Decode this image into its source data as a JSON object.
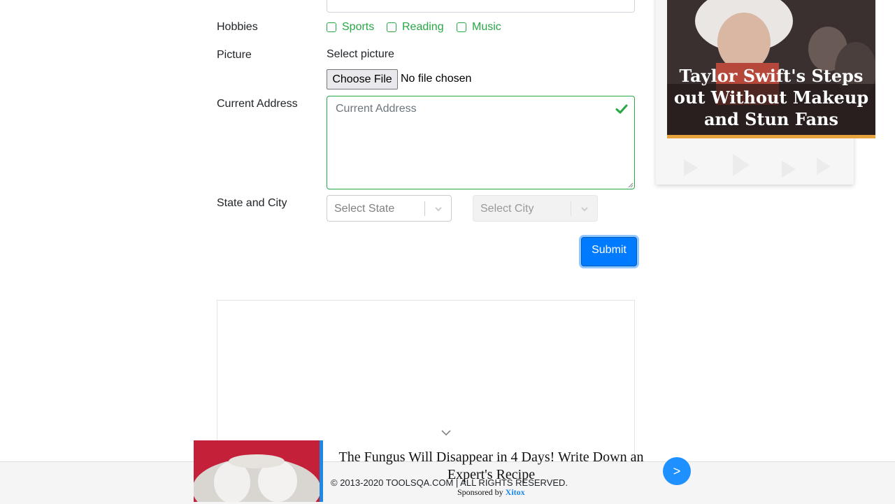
{
  "form": {
    "hobbies_label": "Hobbies",
    "hobbies": [
      "Sports",
      "Reading",
      "Music"
    ],
    "picture_label": "Picture",
    "select_picture": "Select picture",
    "choose_file": "Choose File",
    "file_status": "No file chosen",
    "address_label": "Current Address",
    "address_placeholder": "Current Address",
    "state_city_label": "State and City",
    "state_placeholder": "Select State",
    "city_placeholder": "Select City",
    "submit": "Submit"
  },
  "side_ad": {
    "caption": "Taylor Swift's Steps out Without Makeup and Stun Fans"
  },
  "footer": {
    "copyright": "© 2013-2020 TOOLSQA.COM | ALL RIGHTS RESERVED."
  },
  "bottom_ad": {
    "title": "The Fungus Will Disappear in 4 Days! Write Down an Expert's Recipe",
    "sponsored_prefix": "Sponsored by",
    "sponsor": "Xitox",
    "next": ">"
  },
  "colors": {
    "valid_green": "#28a745",
    "primary_blue": "#007bff",
    "accent_orange": "#e6a23c"
  }
}
